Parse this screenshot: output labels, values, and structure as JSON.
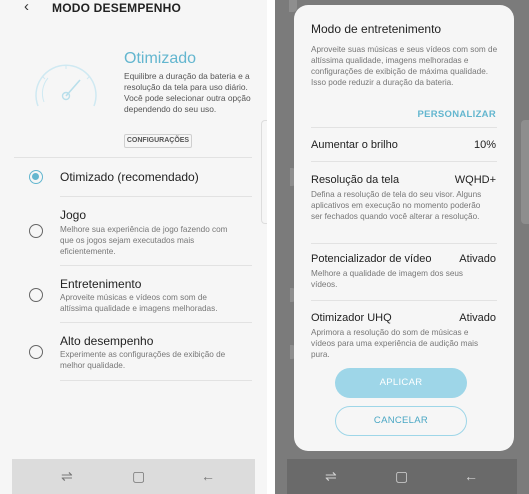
{
  "left": {
    "header": {
      "title": "MODO DESEMPENHO",
      "back_icon": "back-arrow-icon"
    },
    "hero": {
      "title": "Otimizado",
      "description": "Equilibre a duração da bateria e a resolução da tela para uso diário. Você pode selecionar outra opção dependendo do seu uso.",
      "config_button": "CONFIGURAÇÕES"
    },
    "modes": [
      {
        "name": "Otimizado (recomendado)",
        "description": "",
        "selected": true
      },
      {
        "name": "Jogo",
        "description": "Melhore sua experiência de jogo fazendo com que os jogos sejam executados mais eficientemente.",
        "selected": false
      },
      {
        "name": "Entretenimento",
        "description": "Aproveite músicas e vídeos com som de altíssima qualidade e imagens melhoradas.",
        "selected": false
      },
      {
        "name": "Alto desempenho",
        "description": "Experimente as configurações de exibição de melhor qualidade.",
        "selected": false
      }
    ]
  },
  "dialog": {
    "title": "Modo de entretenimento",
    "intro": "Aproveite suas músicas e seus vídeos com som de altíssima qualidade, imagens melhoradas e configurações de exibição de máxima qualidade. Isso pode reduzir a duração da bateria.",
    "customize_link": "PERSONALIZAR",
    "settings": [
      {
        "name": "Aumentar o brilho",
        "value": "10%",
        "description": ""
      },
      {
        "name": "Resolução da tela",
        "value": "WQHD+",
        "description": "Defina a resolução de tela do seu visor. Alguns aplicativos em execução no momento poderão ser fechados quando você alterar a resolução."
      },
      {
        "name": "Potencializador de vídeo",
        "value": "Ativado",
        "description": "Melhore a qualidade de imagem dos seus vídeos."
      },
      {
        "name": "Otimizador UHQ",
        "value": "Ativado",
        "description": "Aprimora a resolução do som de músicas e vídeos para uma experiência de audição mais pura."
      }
    ],
    "apply_button": "APLICAR",
    "cancel_button": "CANCELAR"
  },
  "nav": {
    "recents_icon": "recents-icon",
    "home_icon": "home-icon",
    "back_icon": "nav-back-icon"
  },
  "colors": {
    "accent": "#63b6cf",
    "button_fill": "#9ed6e8",
    "scrim": "#7b7b7b",
    "background": "#f6f6f6"
  }
}
